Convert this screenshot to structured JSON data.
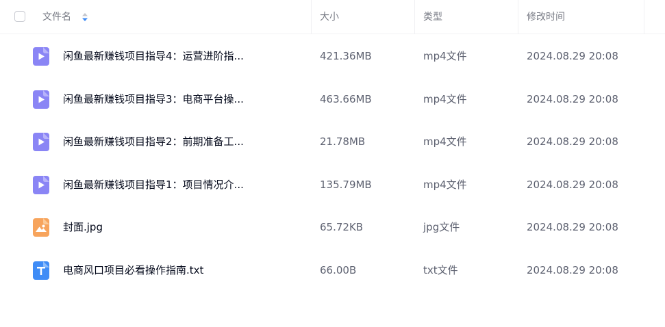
{
  "header": {
    "name_label": "文件名",
    "size_label": "大小",
    "type_label": "类型",
    "modified_label": "修改时间",
    "sort_icon": "sort-arrows-icon"
  },
  "colors": {
    "video_icon": "#8a85f5",
    "image_icon": "#f7a45c",
    "text_icon": "#3f8cf6",
    "sort_active": "#3f8cf6"
  },
  "files": [
    {
      "name": "闲鱼最新赚钱项目指导4：运营进阶指...",
      "size": "421.36MB",
      "type": "mp4文件",
      "modified": "2024.08.29 20:08",
      "icon": "video-file-icon"
    },
    {
      "name": "闲鱼最新赚钱项目指导3：电商平台操...",
      "size": "463.66MB",
      "type": "mp4文件",
      "modified": "2024.08.29 20:08",
      "icon": "video-file-icon"
    },
    {
      "name": "闲鱼最新赚钱项目指导2：前期准备工...",
      "size": "21.78MB",
      "type": "mp4文件",
      "modified": "2024.08.29 20:08",
      "icon": "video-file-icon"
    },
    {
      "name": "闲鱼最新赚钱项目指导1：项目情况介...",
      "size": "135.79MB",
      "type": "mp4文件",
      "modified": "2024.08.29 20:08",
      "icon": "video-file-icon"
    },
    {
      "name": "封面.jpg",
      "size": "65.72KB",
      "type": "jpg文件",
      "modified": "2024.08.29 20:08",
      "icon": "image-file-icon"
    },
    {
      "name": "电商风口项目必看操作指南.txt",
      "size": "66.00B",
      "type": "txt文件",
      "modified": "2024.08.29 20:08",
      "icon": "text-file-icon"
    }
  ]
}
